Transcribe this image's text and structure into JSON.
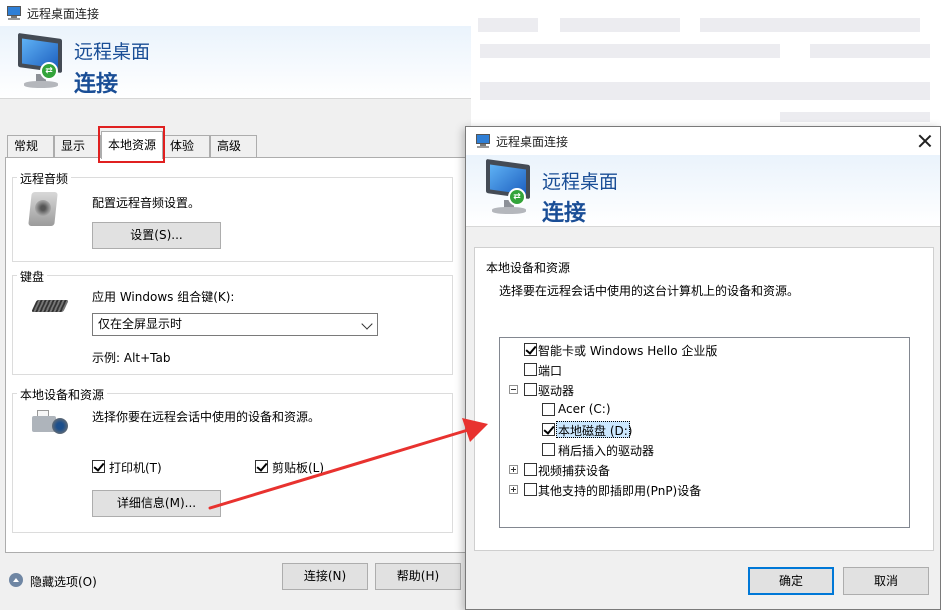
{
  "main_window": {
    "title": "远程桌面连接",
    "banner_line1": "远程桌面",
    "banner_line2": "连接",
    "tabs": [
      {
        "label": "常规"
      },
      {
        "label": "显示"
      },
      {
        "label": "本地资源",
        "active": true
      },
      {
        "label": "体验"
      },
      {
        "label": "高级"
      }
    ],
    "remote_audio": {
      "title": "远程音频",
      "description": "配置远程音频设置。",
      "settings_button": "设置(S)..."
    },
    "keyboard": {
      "title": "键盘",
      "label": "应用 Windows 组合键(K):",
      "selected_option": "仅在全屏显示时",
      "example": "示例: Alt+Tab"
    },
    "local_devices": {
      "title": "本地设备和资源",
      "description": "选择你要在远程会话中使用的设备和资源。",
      "printer_label": "打印机(T)",
      "printer_checked": true,
      "clipboard_label": "剪贴板(L)",
      "clipboard_checked": true,
      "more_button": "详细信息(M)..."
    },
    "hide_options": "隐藏选项(O)",
    "connect_button": "连接(N)",
    "help_button": "帮助(H)"
  },
  "dialog": {
    "title": "远程桌面连接",
    "banner_line1": "远程桌面",
    "banner_line2": "连接",
    "group_title": "本地设备和资源",
    "description": "选择要在远程会话中使用的这台计算机上的设备和资源。",
    "tree": [
      {
        "label": "智能卡或 Windows Hello 企业版",
        "checked": true
      },
      {
        "label": "端口",
        "checked": false
      },
      {
        "label": "驱动器",
        "checked": false,
        "expander": "collapse"
      },
      {
        "label": "Acer (C:)",
        "checked": false
      },
      {
        "label": "本地磁盘 (D:)",
        "checked": true,
        "selected": true
      },
      {
        "label": "稍后插入的驱动器",
        "checked": false
      },
      {
        "label": "视频捕获设备",
        "checked": false,
        "expander": "expand"
      },
      {
        "label": "其他支持的即插即用(PnP)设备",
        "checked": false,
        "expander": "expand"
      }
    ],
    "ok_button": "确定",
    "cancel_button": "取消"
  },
  "colors": {
    "accent_blue": "#0078d7",
    "banner_text": "#1a4e96",
    "highlight_red": "#e02020",
    "arrow_red": "#e8322f",
    "selection_bg": "#cce8ff"
  }
}
